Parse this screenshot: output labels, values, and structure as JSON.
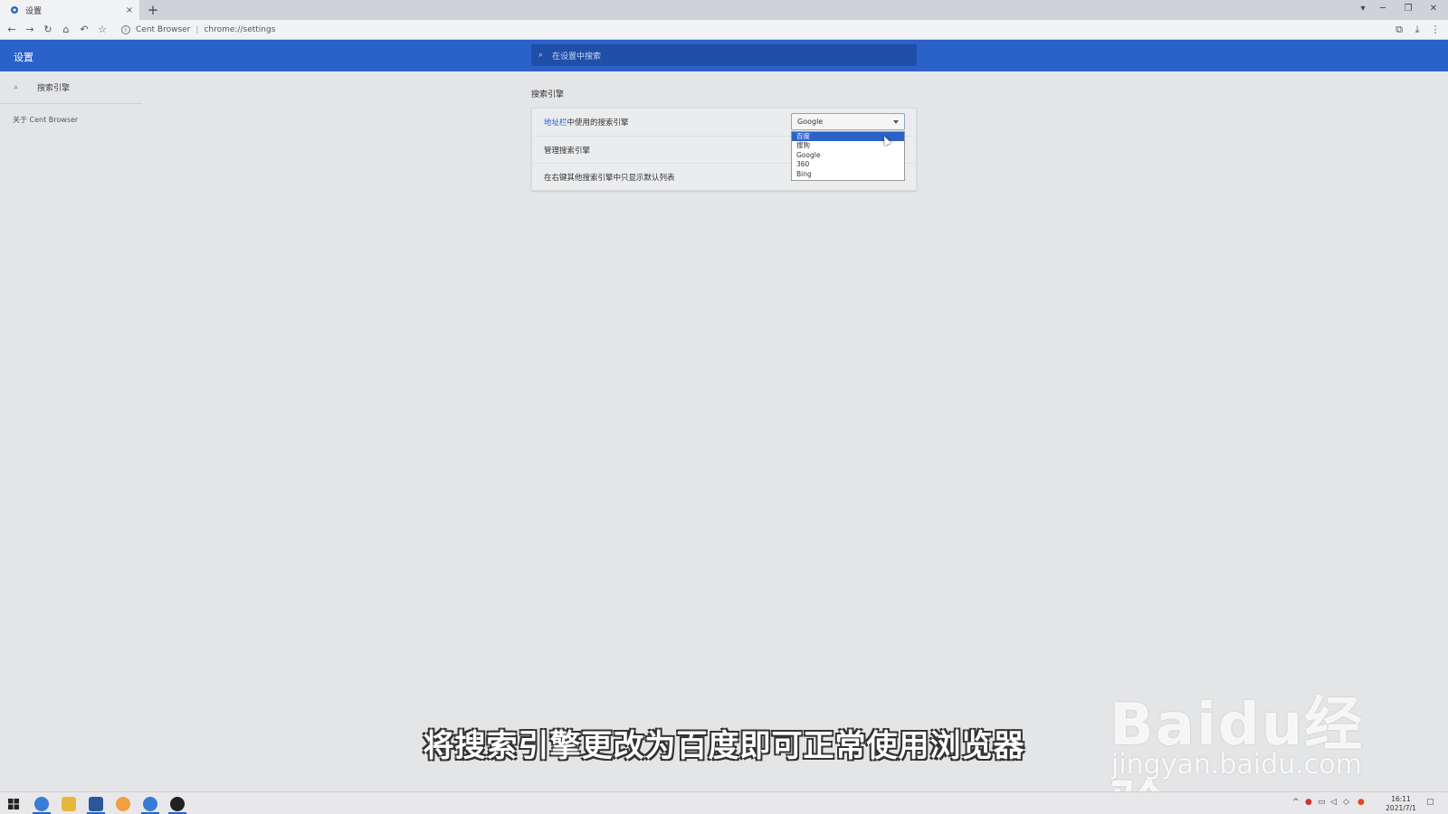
{
  "tab": {
    "title": "设置",
    "close": "×",
    "new": "+"
  },
  "toolbar": {
    "site_name": "Cent Browser",
    "url": "chrome://settings"
  },
  "settings": {
    "header_label": "设置",
    "search_placeholder": "在设置中搜索"
  },
  "sidebar": {
    "search_item": "搜索引擎",
    "about": "关于 Cent Browser"
  },
  "main": {
    "section_title": "搜索引擎",
    "rows": [
      {
        "link_text": "地址栏",
        "text": "中使用的搜索引擎"
      },
      {
        "text": "管理搜索引擎"
      },
      {
        "text": "在右键其他搜索引擎中只显示默认列表"
      }
    ],
    "select_value": "Google",
    "options": [
      "百度",
      "搜狗",
      "Google",
      "360",
      "Bing"
    ],
    "highlighted_option": "百度"
  },
  "overlay": {
    "subtitle": "将搜索引擎更改为百度即可正常使用浏览器",
    "watermark_brand": "Baidu经验",
    "watermark_url": "jingyan.baidu.com"
  },
  "taskbar": {
    "time": "16:11",
    "date": "2021/7/1"
  }
}
